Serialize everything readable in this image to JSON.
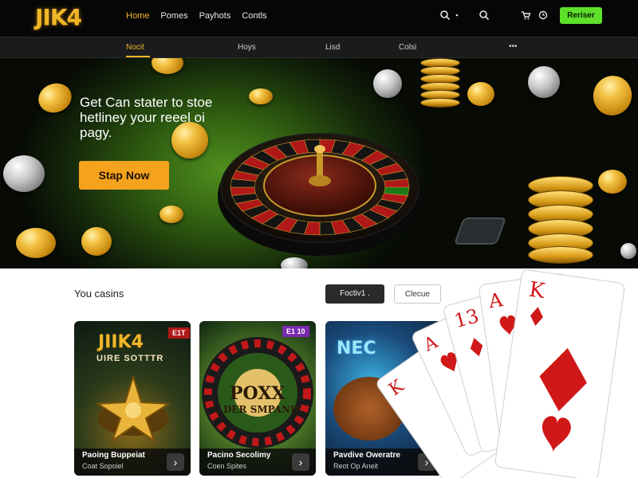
{
  "header": {
    "logo": "JIK4",
    "nav": [
      "Home",
      "Pomes",
      "Payhots",
      "Contls"
    ],
    "cta": "Reriser",
    "colors": {
      "brand": "#f0b528",
      "cta": "#5ee02a",
      "hero_button": "#f5a21d"
    },
    "icons": [
      "search-icon",
      "dots-icon",
      "search-icon",
      "cart-icon",
      "clock-icon"
    ]
  },
  "subnav": {
    "items": [
      "Nocit",
      "Hoys",
      "Lisd",
      "Colsi"
    ],
    "more": "•••"
  },
  "hero": {
    "title": "Get Can stater to stoe hetliney your reeel oi pagy.",
    "button": "Stap Now"
  },
  "section": {
    "title": "You casins",
    "tab_active": "Foctiv1 .",
    "tab_inactive": "Clecue"
  },
  "cards": [
    {
      "art_title": "JIIK4",
      "art_sub": "UIRE SOTTTR",
      "badge": "E1T",
      "name": "Paoing Buppeiat",
      "sub": "Coat Sopoiel"
    },
    {
      "art_title": "POXX",
      "art_sub": "DER SMPAND",
      "badge": "E1 10",
      "name": "Pacino Secolimy",
      "sub": "Coen Spites"
    },
    {
      "art_title": "NEC",
      "art_sub": "",
      "badge": "",
      "name": "Pavdive Oweratre",
      "sub": "Reot Op Aneit"
    }
  ],
  "playing_cards": [
    "K",
    "A",
    "13",
    "A",
    "K"
  ]
}
